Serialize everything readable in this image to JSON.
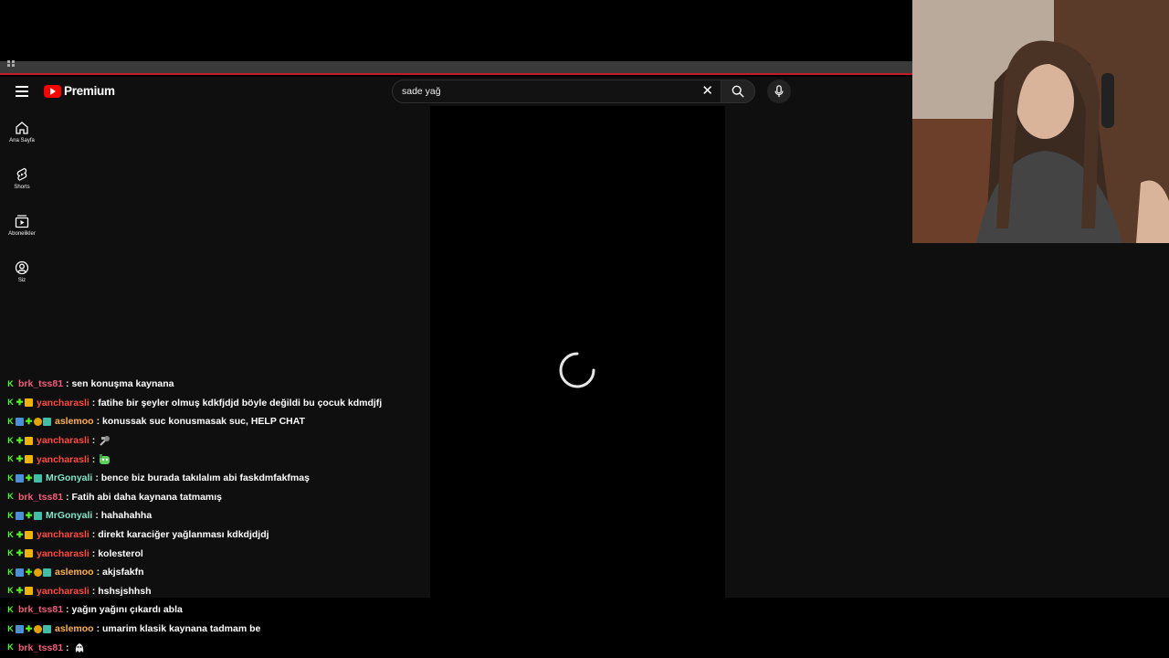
{
  "masthead": {
    "brand": "Premium",
    "search_value": "sade yağ"
  },
  "sidebar": {
    "items": [
      {
        "label": "Ana Sayfa",
        "icon": "home-icon"
      },
      {
        "label": "Shorts",
        "icon": "shorts-icon"
      },
      {
        "label": "Abonelikler",
        "icon": "subscriptions-icon"
      },
      {
        "label": "Siz",
        "icon": "you-icon"
      }
    ]
  },
  "colors": {
    "user_brk": "#f65c7d",
    "user_yan": "#ff4a3d",
    "user_asl": "#ffb347",
    "user_mrg": "#7fe6c7",
    "brand_red": "#ff0000"
  },
  "chat": [
    {
      "user": "brk_tss81",
      "text": ": sen konuşma kaynana",
      "color": "#f65c7d",
      "badges": [
        "k"
      ]
    },
    {
      "user": "yancharasli",
      "text": ": fatihe bir şeyler olmuş kdkfjdjd böyle değildi bu çocuk kdmdjfj",
      "color": "#ff4a3d",
      "badges": [
        "k",
        "g",
        "c"
      ]
    },
    {
      "user": "aslemoo",
      "text": ": konussak suc konusmasak suc, HELP CHAT",
      "color": "#ffb347",
      "badges": [
        "k",
        "b",
        "g",
        "o",
        "t"
      ]
    },
    {
      "user": "yancharasli",
      "text": ":",
      "color": "#ff4a3d",
      "badges": [
        "k",
        "g",
        "c"
      ],
      "emote": "satellite-emote"
    },
    {
      "user": "yancharasli",
      "text": ":",
      "color": "#ff4a3d",
      "badges": [
        "k",
        "g",
        "c"
      ],
      "emote": "green-blob-emote"
    },
    {
      "user": "MrGonyali",
      "text": ": bence biz burada takılalım abi faskdmfakfmaş",
      "color": "#7fe6c7",
      "badges": [
        "k",
        "b",
        "g",
        "t"
      ]
    },
    {
      "user": "brk_tss81",
      "text": ": Fatih abi daha kaynana tatmamış",
      "color": "#f65c7d",
      "badges": [
        "k"
      ]
    },
    {
      "user": "MrGonyali",
      "text": ": hahahahha",
      "color": "#7fe6c7",
      "badges": [
        "k",
        "b",
        "g",
        "t"
      ]
    },
    {
      "user": "yancharasli",
      "text": ": direkt karaciğer yağlanması kdkdjdjdj",
      "color": "#ff4a3d",
      "badges": [
        "k",
        "g",
        "c"
      ]
    },
    {
      "user": "yancharasli",
      "text": ": kolesterol",
      "color": "#ff4a3d",
      "badges": [
        "k",
        "g",
        "c"
      ]
    },
    {
      "user": "aslemoo",
      "text": ": akjsfakfn",
      "color": "#ffb347",
      "badges": [
        "k",
        "b",
        "g",
        "o",
        "t"
      ]
    },
    {
      "user": "yancharasli",
      "text": ": hshsjshhsh",
      "color": "#ff4a3d",
      "badges": [
        "k",
        "g",
        "c"
      ]
    },
    {
      "user": "brk_tss81",
      "text": ": yağın yağını çıkardı abla",
      "color": "#f65c7d",
      "badges": [
        "k"
      ]
    },
    {
      "user": "aslemoo",
      "text": ": umarim klasik kaynana tadmam be",
      "color": "#ffb347",
      "badges": [
        "k",
        "b",
        "g",
        "o",
        "t"
      ]
    },
    {
      "user": "brk_tss81",
      "text": ":",
      "color": "#f65c7d",
      "badges": [
        "k"
      ],
      "emote": "ghost-emote"
    }
  ]
}
